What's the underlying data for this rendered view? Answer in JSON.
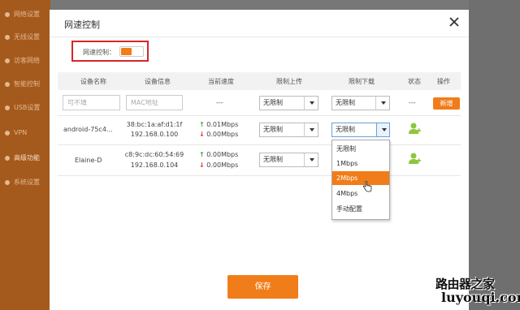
{
  "background": {
    "sidebar_items": [
      "网络设置",
      "无线设置",
      "访客网络",
      "智能控制",
      "USB设置",
      "VPN",
      "高级功能",
      "系统设置"
    ],
    "active_index": 6
  },
  "modal": {
    "title": "网速控制",
    "toggle_label": "网速控制：",
    "toggle_on": true
  },
  "table": {
    "headers": [
      "设备名称",
      "设备信息",
      "当前速度",
      "限制上传",
      "限制下载",
      "状态",
      "操作"
    ],
    "new_row": {
      "name_placeholder": "可不填",
      "mac_placeholder": "MAC地址",
      "speed": "---",
      "upload": "无限制",
      "download": "无限制",
      "status": "---",
      "action_label": "新增"
    },
    "rows": [
      {
        "name": "android-75c4...",
        "mac": "38:bc:1a:af:d1:1f",
        "ip": "192.168.0.100",
        "up_speed": "0.01Mbps",
        "down_speed": "0.00Mbps",
        "upload": "无限制",
        "download": "无限制"
      },
      {
        "name": "Elaine-D",
        "mac": "c8:9c:dc:60:54:69",
        "ip": "192.168.0.104",
        "up_speed": "0.00Mbps",
        "down_speed": "0.00Mbps",
        "upload": "无限制",
        "download": "无限制"
      }
    ]
  },
  "dropdown": {
    "options": [
      "无限制",
      "1Mbps",
      "2Mbps",
      "4Mbps",
      "手动配置"
    ],
    "selected_index": 2
  },
  "save_label": "保存",
  "watermark": {
    "line1": "路由器之家",
    "line2": "luyouqi.com"
  },
  "colors": {
    "accent": "#f07d19",
    "highlight_border": "#d4262a",
    "up_arrow": "#3aa640",
    "down_arrow": "#d9322b",
    "user_icon": "#8cc63f"
  }
}
